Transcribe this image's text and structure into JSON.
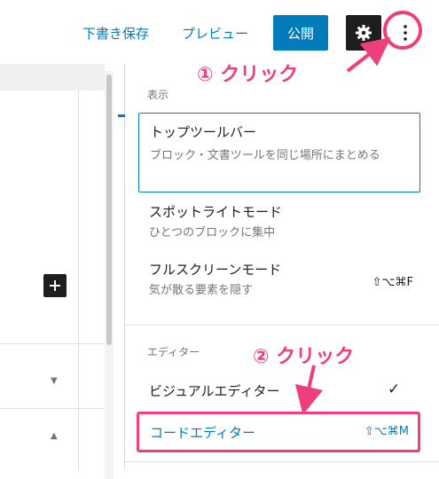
{
  "toolbar": {
    "save_draft": "下書き保存",
    "preview": "プレビュー",
    "publish": "公開",
    "settings_icon": "gear-icon",
    "more_icon": "vertical-ellipsis-icon"
  },
  "menu": {
    "view_section": "表示",
    "items": [
      {
        "title": "トップツールバー",
        "desc": "ブロック・文書ツールを同じ場所にまとめる"
      },
      {
        "title": "スポットライトモード",
        "desc": "ひとつのブロックに集中"
      },
      {
        "title": "フルスクリーンモード",
        "desc": "気が散る要素を隠す",
        "shortcut": "⇧⌥⌘F"
      }
    ],
    "editor_section": "エディター",
    "visual_editor": "ビジュアルエディター",
    "visual_check": "✓",
    "code_editor": "コードエディター",
    "code_shortcut": "⇧⌥⌘M"
  },
  "annotations": {
    "step1": "① クリック",
    "step2": "② クリック"
  },
  "colors": {
    "accent": "#007cba",
    "annotation": "#ee3f7c",
    "dark": "#1e1e1e"
  }
}
